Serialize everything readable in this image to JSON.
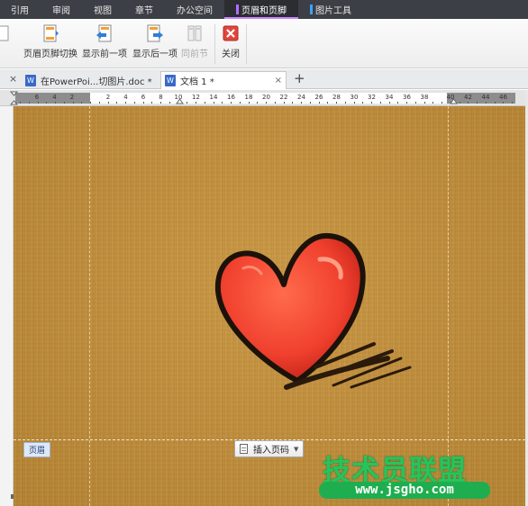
{
  "menu": {
    "items": [
      {
        "label": "引用"
      },
      {
        "label": "审阅"
      },
      {
        "label": "视图"
      },
      {
        "label": "章节"
      },
      {
        "label": "办公空间"
      },
      {
        "label": "页眉和页脚",
        "active": true,
        "accent": "#b46cff"
      },
      {
        "label": "图片工具",
        "accent": "#3ca3ff"
      }
    ]
  },
  "toolbar": {
    "switch_label": "页眉页脚切换",
    "prev_label": "显示前一项",
    "next_label": "显示后一项",
    "same_label": "同前节",
    "close_label": "关闭"
  },
  "tabs": {
    "items": [
      {
        "label": "在PowerPoi...切图片.doc *",
        "icon": "word-doc-icon"
      },
      {
        "label": "文档 1 *",
        "icon": "word-doc-icon",
        "active": true
      }
    ],
    "new_tab": "+",
    "close_glyph": "×"
  },
  "ruler": {
    "left_ticks": [
      "6",
      "4",
      "2"
    ],
    "ticks": [
      "2",
      "4",
      "6",
      "8",
      "10",
      "12",
      "14",
      "16",
      "18",
      "20",
      "22",
      "24",
      "26",
      "28",
      "30",
      "32",
      "34",
      "36",
      "38"
    ],
    "right_ticks": [
      "40",
      "42",
      "44",
      "46"
    ]
  },
  "page": {
    "header_label": "页眉",
    "insert_page_number": "插入页码",
    "background_color": "#c18e3a"
  },
  "watermark": {
    "text": "技术员联盟",
    "url": "www.jsgho.com",
    "color": "#26c45d"
  }
}
